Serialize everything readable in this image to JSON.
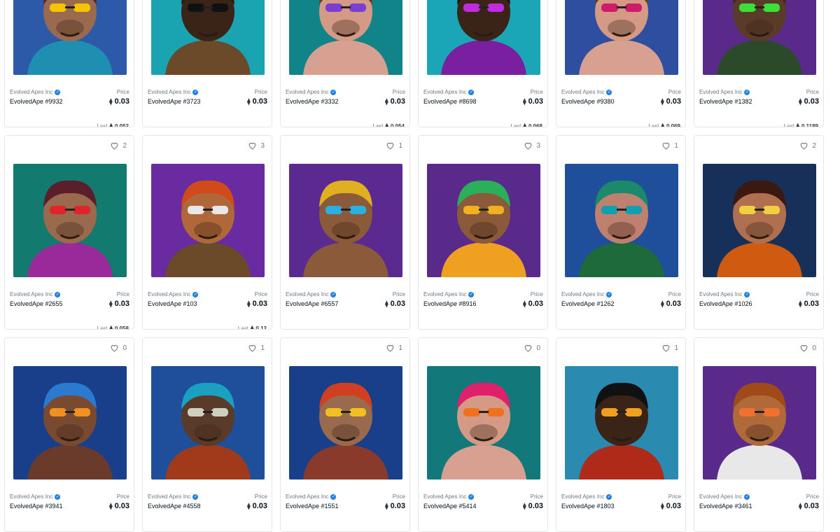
{
  "ui": {
    "price_label": "Price",
    "last_label": "Last",
    "eth_icon": "eth-icon",
    "fav_icon": "heart-icon",
    "verified_icon": "verified-badge-icon",
    "verified_glyph": "✓",
    "eth_glyph": "⧫"
  },
  "cards": [
    {
      "collection": "Evolved Apes Inc",
      "name": "EvolvedApe #9932",
      "price": "0.03",
      "last": "0.052",
      "favorites": "",
      "bg": "#2d5aa8",
      "shirt": "#1e8fb0",
      "skin": "#9a6a4e",
      "hair": "#5a1f2a",
      "glasses": "#f5c400"
    },
    {
      "collection": "Evolved Apes Inc",
      "name": "EvolvedApe #3723",
      "price": "0.03",
      "last": "",
      "favorites": "",
      "bg": "#1aa3b0",
      "shirt": "#6b4a2a",
      "skin": "#3a2418",
      "hair": "#2a1a10",
      "glasses": "#111111"
    },
    {
      "collection": "Evolved Apes Inc",
      "name": "EvolvedApe #3332",
      "price": "0.03",
      "last": "0.054",
      "favorites": "",
      "bg": "#11848a",
      "shirt": "#d8a090",
      "skin": "#d59a86",
      "hair": "#6a3a20",
      "glasses": "#7a3fd0"
    },
    {
      "collection": "Evolved Apes Inc",
      "name": "EvolvedApe #8698",
      "price": "0.03",
      "last": "0.068",
      "favorites": "",
      "bg": "#1ba6b8",
      "shirt": "#7a1fa0",
      "skin": "#3a2418",
      "hair": "#1a1210",
      "glasses": "#c02be0"
    },
    {
      "collection": "Evolved Apes Inc",
      "name": "EvolvedApe #9380",
      "price": "0.03",
      "last": "0.069",
      "favorites": "",
      "bg": "#2e4fa0",
      "shirt": "#d8a090",
      "skin": "#d59a86",
      "hair": "#6a3a20",
      "glasses": "#d01a6a"
    },
    {
      "collection": "Evolved Apes Inc",
      "name": "EvolvedApe #1382",
      "price": "0.03",
      "last": "0.1189",
      "favorites": "",
      "bg": "#5a2a8a",
      "shirt": "#2a4a2a",
      "skin": "#5a3a28",
      "hair": "#3a2a1a",
      "glasses": "#3adf3a"
    },
    {
      "collection": "Evolved Apes Inc",
      "name": "EvolvedApe #2655",
      "price": "0.03",
      "last": "0.058",
      "favorites": "2",
      "bg": "#127a6e",
      "shirt": "#9a2a9a",
      "skin": "#9a6a4e",
      "hair": "#5a1f2a",
      "glasses": "#e0242a"
    },
    {
      "collection": "Evolved Apes Inc",
      "name": "EvolvedApe #103",
      "price": "0.03",
      "last": "0.12",
      "favorites": "3",
      "bg": "#6a2aa0",
      "shirt": "#6b4a2a",
      "skin": "#b0683a",
      "hair": "#d04a1a",
      "glasses": "#e8e8e8"
    },
    {
      "collection": "Evolved Apes Inc",
      "name": "EvolvedApe #6557",
      "price": "0.03",
      "last": "",
      "favorites": "1",
      "bg": "#5a2a90",
      "shirt": "#8a5a3a",
      "skin": "#8a5a3a",
      "hair": "#e0b020",
      "glasses": "#2ab0e0"
    },
    {
      "collection": "Evolved Apes Inc",
      "name": "EvolvedApe #8916",
      "price": "0.03",
      "last": "",
      "favorites": "3",
      "bg": "#5a2a8a",
      "shirt": "#f0a020",
      "skin": "#8a5a3a",
      "hair": "#2ab05a",
      "glasses": "#f0b020"
    },
    {
      "collection": "Evolved Apes Inc",
      "name": "EvolvedApe #1262",
      "price": "0.03",
      "last": "",
      "favorites": "1",
      "bg": "#1f4f9a",
      "shirt": "#1f6a3a",
      "skin": "#c08070",
      "hair": "#1a8a6a",
      "glasses": "#10a0b0"
    },
    {
      "collection": "Evolved Apes Inc",
      "name": "EvolvedApe #1026",
      "price": "0.03",
      "last": "",
      "favorites": "2",
      "bg": "#17305a",
      "shirt": "#d05a10",
      "skin": "#b07050",
      "hair": "#3a1a10",
      "glasses": "#f0d040"
    },
    {
      "collection": "Evolved Apes Inc",
      "name": "EvolvedApe #3941",
      "price": "0.03",
      "last": "",
      "favorites": "0",
      "bg": "#1a3f8a",
      "shirt": "#6a3a2a",
      "skin": "#7a4a30",
      "hair": "#2a7ad0",
      "glasses": "#f09020"
    },
    {
      "collection": "Evolved Apes Inc",
      "name": "EvolvedApe #4558",
      "price": "0.03",
      "last": "",
      "favorites": "1",
      "bg": "#1f4f9a",
      "shirt": "#a03a1a",
      "skin": "#5a3a28",
      "hair": "#1aa0c0",
      "glasses": "#d0d0c0"
    },
    {
      "collection": "Evolved Apes Inc",
      "name": "EvolvedApe #1551",
      "price": "0.03",
      "last": "",
      "favorites": "1",
      "bg": "#1a3f8a",
      "shirt": "#8a3a2a",
      "skin": "#9a6a4e",
      "hair": "#d04020",
      "glasses": "#f0c020"
    },
    {
      "collection": "Evolved Apes Inc",
      "name": "EvolvedApe #5414",
      "price": "0.03",
      "last": "",
      "favorites": "0",
      "bg": "#13787a",
      "shirt": "#d8a090",
      "skin": "#d59a86",
      "hair": "#e0206a",
      "glasses": "#f07020"
    },
    {
      "collection": "Evolved Apes Inc",
      "name": "EvolvedApe #1803",
      "price": "0.03",
      "last": "",
      "favorites": "1",
      "bg": "#2a8ab0",
      "shirt": "#b02a1a",
      "skin": "#3a2418",
      "hair": "#111111",
      "glasses": "#f0a020"
    },
    {
      "collection": "Evolved Apes Inc",
      "name": "EvolvedApe #3461",
      "price": "0.03",
      "last": "",
      "favorites": "0",
      "bg": "#5a2a8a",
      "shirt": "#e8e8e8",
      "skin": "#b06a3a",
      "hair": "#a04a1a",
      "glasses": "#f07030"
    }
  ]
}
